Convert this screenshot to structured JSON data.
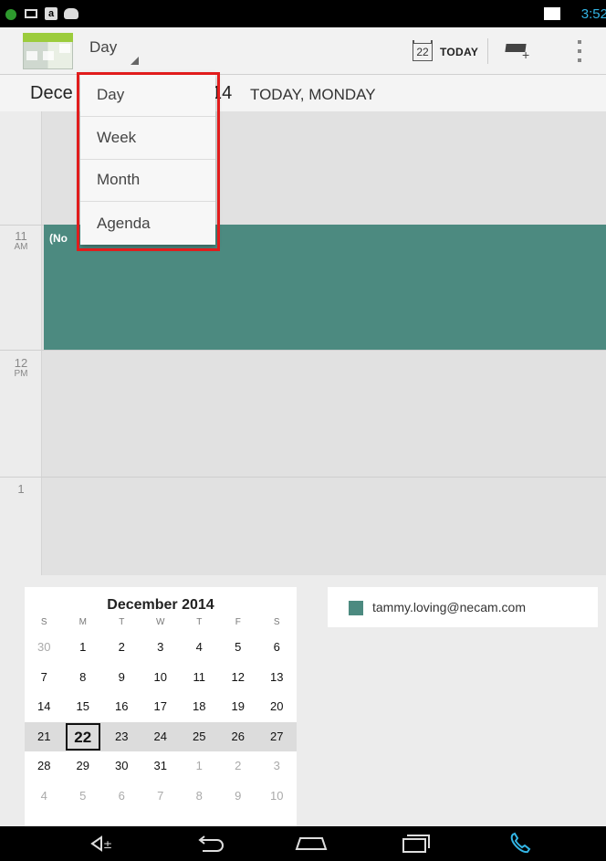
{
  "status_bar": {
    "time": "3:52"
  },
  "action_bar": {
    "view_label": "Day",
    "today_date": "22",
    "today_label": "TODAY"
  },
  "date_header": {
    "month_fragment": "Dece",
    "year_fragment": "14",
    "suffix": "TODAY, MONDAY"
  },
  "dropdown": {
    "items": [
      "Day",
      "Week",
      "Month",
      "Agenda"
    ]
  },
  "day_view": {
    "hours": [
      {
        "num": "11",
        "ampm": "AM"
      },
      {
        "num": "12",
        "ampm": "PM"
      },
      {
        "num": "1",
        "ampm": ""
      }
    ],
    "event_title": "(No"
  },
  "mini_calendar": {
    "title": "December 2014",
    "dow": [
      "S",
      "M",
      "T",
      "W",
      "T",
      "F",
      "S"
    ],
    "weeks": [
      [
        "30",
        "1",
        "2",
        "3",
        "4",
        "5",
        "6"
      ],
      [
        "7",
        "8",
        "9",
        "10",
        "11",
        "12",
        "13"
      ],
      [
        "14",
        "15",
        "16",
        "17",
        "18",
        "19",
        "20"
      ],
      [
        "21",
        "22",
        "23",
        "24",
        "25",
        "26",
        "27"
      ],
      [
        "28",
        "29",
        "30",
        "31",
        "1",
        "2",
        "3"
      ],
      [
        "4",
        "5",
        "6",
        "7",
        "8",
        "9",
        "10"
      ]
    ],
    "today": "22"
  },
  "calendars": {
    "account": "tammy.loving@necam.com",
    "color": "#4c8a80"
  },
  "nav_bar": {
    "buttons": [
      "volume",
      "back",
      "home",
      "recents",
      "phone"
    ]
  }
}
